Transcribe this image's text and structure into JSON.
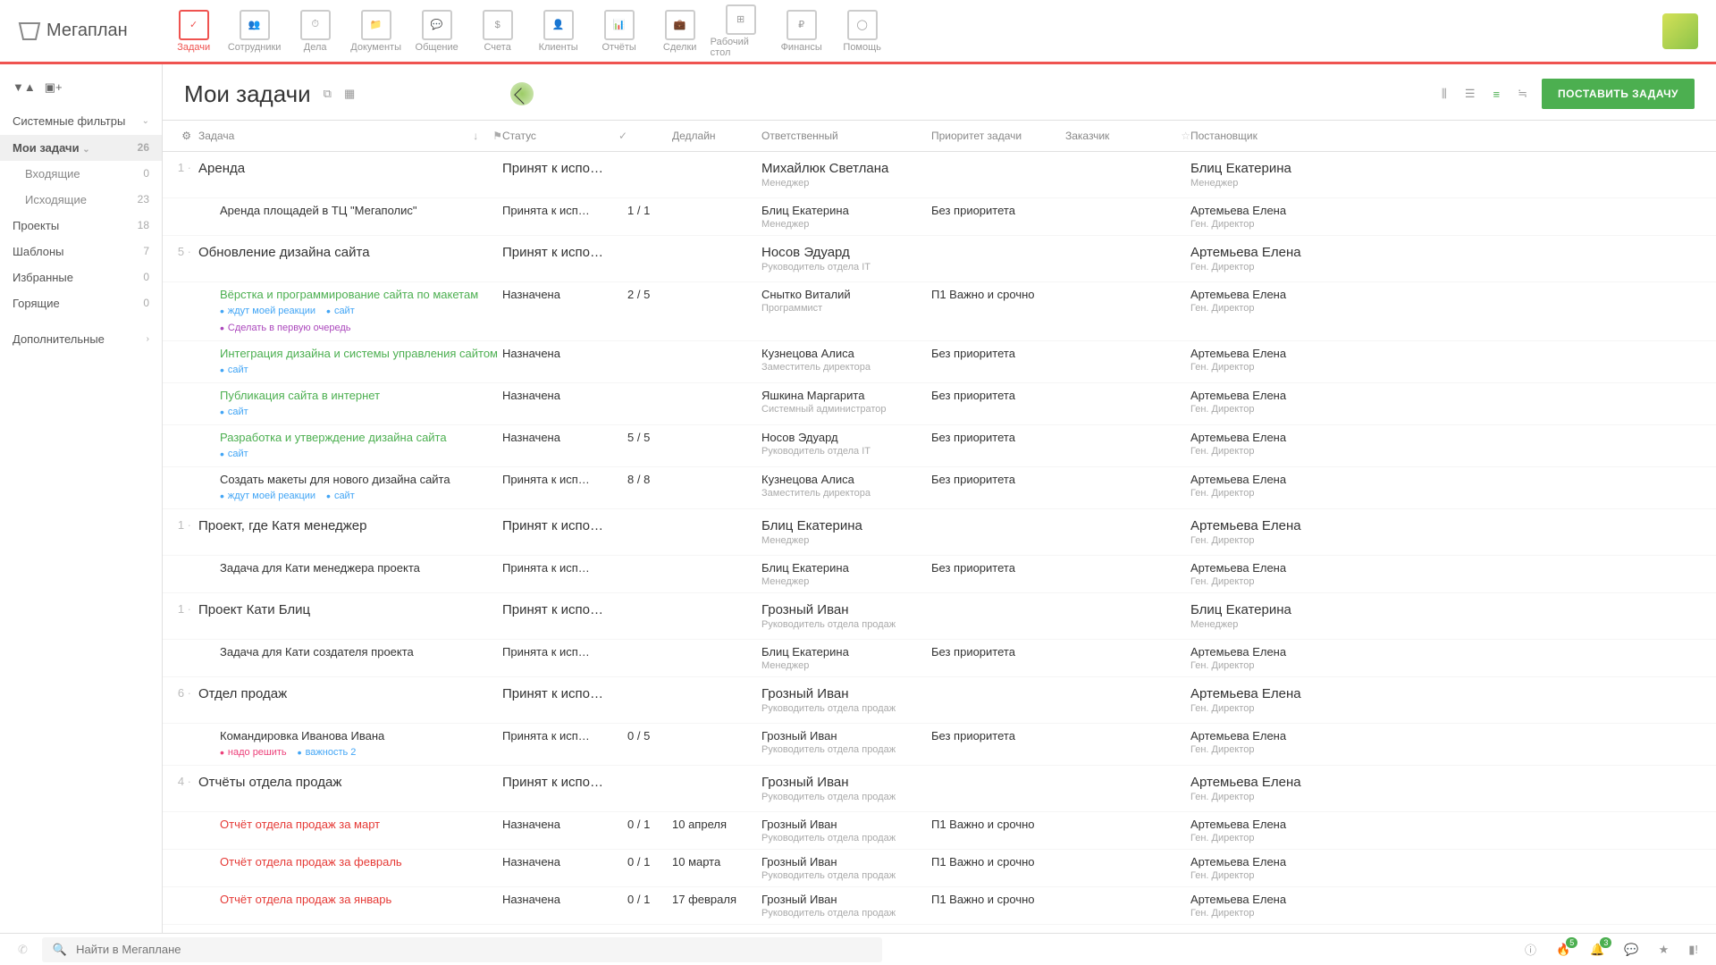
{
  "nav": [
    {
      "label": "Задачи",
      "active": true
    },
    {
      "label": "Сотрудники"
    },
    {
      "label": "Дела"
    },
    {
      "label": "Документы"
    },
    {
      "label": "Общение"
    },
    {
      "label": "Счета"
    },
    {
      "label": "Клиенты"
    },
    {
      "label": "Отчёты"
    },
    {
      "label": "Сделки"
    },
    {
      "label": "Рабочий стол"
    },
    {
      "label": "Финансы"
    },
    {
      "label": "Помощь"
    }
  ],
  "sidebar": {
    "system_filters": "Системные фильтры",
    "items": [
      {
        "label": "Мои задачи",
        "count": "26",
        "active": true,
        "expand": true
      },
      {
        "label": "Входящие",
        "count": "0",
        "sub": true
      },
      {
        "label": "Исходящие",
        "count": "23",
        "sub": true
      },
      {
        "label": "Проекты",
        "count": "18"
      },
      {
        "label": "Шаблоны",
        "count": "7"
      },
      {
        "label": "Избранные",
        "count": "0"
      },
      {
        "label": "Горящие",
        "count": "0"
      }
    ],
    "additional": "Дополнительные"
  },
  "page": {
    "title": "Мои задачи",
    "create_btn": "ПОСТАВИТЬ ЗАДАЧУ"
  },
  "columns": {
    "task": "Задача",
    "status": "Статус",
    "deadline": "Дедлайн",
    "resp": "Ответственный",
    "prio": "Приоритет задачи",
    "cust": "Заказчик",
    "setter": "Постановщик"
  },
  "rows": [
    {
      "type": "group",
      "idx": "1",
      "name": "Аренда",
      "status": "Принят к испо…",
      "resp": "Михайлюк Светлана",
      "role": "Менеджер",
      "setter": "Блиц Екатерина",
      "srole": "Менеджер"
    },
    {
      "type": "sub",
      "name": "Аренда площадей в ТЦ \"Мегаполис\"",
      "status": "Принята к исп…",
      "count": "1 / 1",
      "resp": "Блиц Екатерина",
      "role": "Менеджер",
      "prio": "Без приоритета",
      "setter": "Артемьева Елена",
      "srole": "Ген. Директор"
    },
    {
      "type": "group",
      "idx": "5",
      "name": "Обновление дизайна сайта",
      "status": "Принят к испо…",
      "resp": "Носов Эдуард",
      "role": "Руководитель отдела IT",
      "setter": "Артемьева Елена",
      "srole": "Ген. Директор"
    },
    {
      "type": "sub",
      "name": "Вёрстка и программирование сайта по макетам",
      "color": "green",
      "status": "Назначена",
      "count": "2 / 5",
      "resp": "Снытко Виталий",
      "role": "Программист",
      "prio": "П1 Важно и срочно",
      "setter": "Артемьева Елена",
      "srole": "Ген. Директор",
      "tags": [
        {
          "t": "ждут моей реакции",
          "c": "blue"
        },
        {
          "t": "сайт",
          "c": "blue"
        }
      ],
      "tags2": [
        {
          "t": "Сделать в первую очередь",
          "c": "purple"
        }
      ]
    },
    {
      "type": "sub",
      "name": "Интеграция дизайна и системы управления сайтом",
      "color": "green",
      "status": "Назначена",
      "resp": "Кузнецова Алиса",
      "role": "Заместитель директора",
      "prio": "Без приоритета",
      "setter": "Артемьева Елена",
      "srole": "Ген. Директор",
      "tags": [
        {
          "t": "сайт",
          "c": "blue"
        }
      ]
    },
    {
      "type": "sub",
      "name": "Публикация сайта в интернет",
      "color": "green",
      "status": "Назначена",
      "resp": "Яшкина Маргарита",
      "role": "Системный администратор",
      "prio": "Без приоритета",
      "setter": "Артемьева Елена",
      "srole": "Ген. Директор",
      "tags": [
        {
          "t": "сайт",
          "c": "blue"
        }
      ]
    },
    {
      "type": "sub",
      "name": "Разработка и утверждение дизайна сайта",
      "color": "green",
      "status": "Назначена",
      "count": "5 / 5",
      "resp": "Носов Эдуард",
      "role": "Руководитель отдела IT",
      "prio": "Без приоритета",
      "setter": "Артемьева Елена",
      "srole": "Ген. Директор",
      "tags": [
        {
          "t": "сайт",
          "c": "blue"
        }
      ]
    },
    {
      "type": "sub",
      "name": "Создать макеты для нового дизайна сайта",
      "status": "Принята к исп…",
      "count": "8 / 8",
      "resp": "Кузнецова Алиса",
      "role": "Заместитель директора",
      "prio": "Без приоритета",
      "setter": "Артемьева Елена",
      "srole": "Ген. Директор",
      "tags": [
        {
          "t": "ждут моей реакции",
          "c": "blue"
        },
        {
          "t": "сайт",
          "c": "blue"
        }
      ]
    },
    {
      "type": "group",
      "idx": "1",
      "name": "Проект, где Катя менеджер",
      "status": "Принят к испо…",
      "resp": "Блиц Екатерина",
      "role": "Менеджер",
      "setter": "Артемьева Елена",
      "srole": "Ген. Директор"
    },
    {
      "type": "sub",
      "name": "Задача для Кати менеджера проекта",
      "status": "Принята к исп…",
      "resp": "Блиц Екатерина",
      "role": "Менеджер",
      "prio": "Без приоритета",
      "setter": "Артемьева Елена",
      "srole": "Ген. Директор"
    },
    {
      "type": "group",
      "idx": "1",
      "name": "Проект Кати Блиц",
      "status": "Принят к испо…",
      "resp": "Грозный Иван",
      "role": "Руководитель отдела продаж",
      "setter": "Блиц Екатерина",
      "srole": "Менеджер"
    },
    {
      "type": "sub",
      "name": "Задача для Кати создателя проекта",
      "status": "Принята к исп…",
      "resp": "Блиц Екатерина",
      "role": "Менеджер",
      "prio": "Без приоритета",
      "setter": "Артемьева Елена",
      "srole": "Ген. Директор"
    },
    {
      "type": "group",
      "idx": "6",
      "name": "Отдел продаж",
      "status": "Принят к испо…",
      "resp": "Грозный Иван",
      "role": "Руководитель отдела продаж",
      "setter": "Артемьева Елена",
      "srole": "Ген. Директор"
    },
    {
      "type": "sub",
      "name": "Командировка Иванова Ивана",
      "status": "Принята к исп…",
      "count": "0 / 5",
      "resp": "Грозный Иван",
      "role": "Руководитель отдела продаж",
      "prio": "Без приоритета",
      "setter": "Артемьева Елена",
      "srole": "Ген. Директор",
      "tags": [
        {
          "t": "надо решить",
          "c": "pink"
        },
        {
          "t": "важность 2",
          "c": "blue"
        }
      ]
    },
    {
      "type": "group",
      "idx": "4",
      "name": "Отчёты отдела продаж",
      "status": "Принят к испо…",
      "resp": "Грозный Иван",
      "role": "Руководитель отдела продаж",
      "setter": "Артемьева Елена",
      "srole": "Ген. Директор"
    },
    {
      "type": "sub",
      "name": "Отчёт отдела продаж за март",
      "color": "red",
      "status": "Назначена",
      "count": "0 / 1",
      "deadline": "10 апреля",
      "resp": "Грозный Иван",
      "role": "Руководитель отдела продаж",
      "prio": "П1 Важно и срочно",
      "setter": "Артемьева Елена",
      "srole": "Ген. Директор"
    },
    {
      "type": "sub",
      "name": "Отчёт отдела продаж за февраль",
      "color": "red",
      "status": "Назначена",
      "count": "0 / 1",
      "deadline": "10 марта",
      "resp": "Грозный Иван",
      "role": "Руководитель отдела продаж",
      "prio": "П1 Важно и срочно",
      "setter": "Артемьева Елена",
      "srole": "Ген. Директор"
    },
    {
      "type": "sub",
      "name": "Отчёт отдела продаж за январь",
      "color": "red",
      "status": "Назначена",
      "count": "0 / 1",
      "deadline": "17 февраля",
      "resp": "Грозный Иван",
      "role": "Руководитель отдела продаж",
      "prio": "П1 Важно и срочно",
      "setter": "Артемьева Елена",
      "srole": "Ген. Директор"
    }
  ],
  "search": {
    "placeholder": "Найти в Мегаплане"
  },
  "badges": {
    "fire": "5",
    "bell": "3"
  }
}
